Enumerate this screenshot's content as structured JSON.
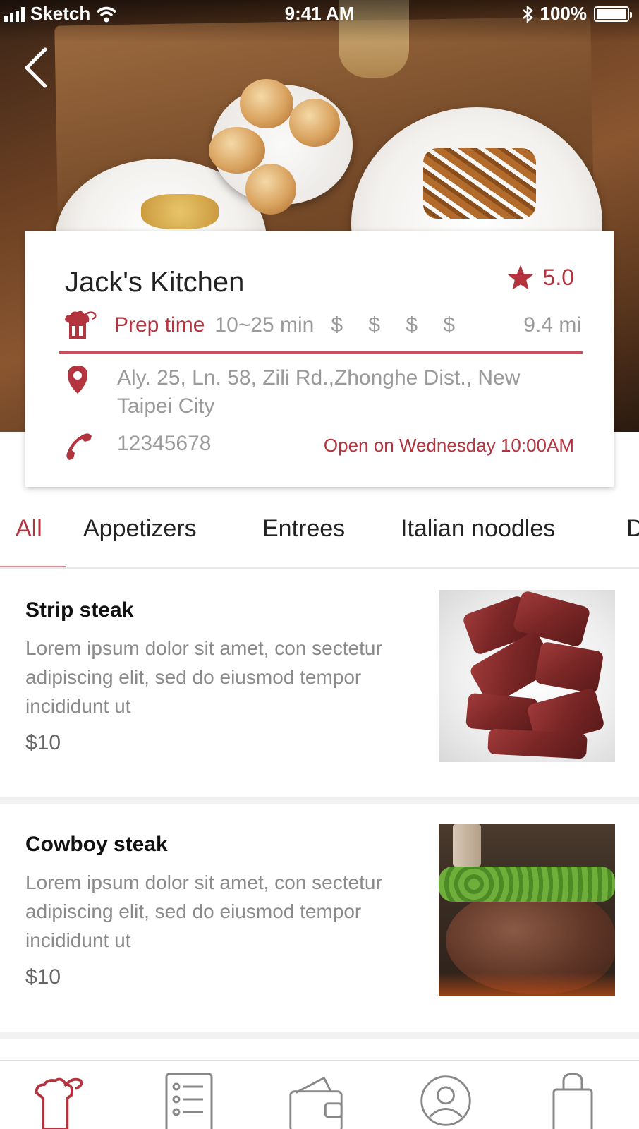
{
  "status_bar": {
    "carrier": "Sketch",
    "time": "9:41 AM",
    "battery": "100%",
    "icons": [
      "signal-icon",
      "wifi-icon",
      "bluetooth-icon",
      "battery-icon"
    ]
  },
  "header": {
    "back_icon": "back-arrow-icon"
  },
  "restaurant": {
    "name": "Jack's Kitchen",
    "rating": "5.0",
    "prep_label": "Prep time",
    "prep_value": "10~25 min",
    "price_level": "$ $ $ $",
    "distance": "9.4 mi",
    "address": "Aly. 25, Ln. 58, Zili Rd.,Zhonghe Dist., New Taipei City",
    "phone": "12345678",
    "hours": "Open on Wednesday 10:00AM"
  },
  "tabs": [
    {
      "label": "All",
      "active": true
    },
    {
      "label": "Appetizers",
      "active": false
    },
    {
      "label": "Entrees",
      "active": false
    },
    {
      "label": "Italian noodles",
      "active": false
    },
    {
      "label": "D",
      "active": false
    }
  ],
  "menu": [
    {
      "title": "Strip steak",
      "description": "Lorem ipsum dolor sit amet, con sectetur adipiscing elit, sed do eiusmod tempor incididunt ut",
      "price": "$10"
    },
    {
      "title": "Cowboy steak",
      "description": "Lorem ipsum dolor sit amet, con sectetur adipiscing elit, sed do eiusmod tempor incididunt ut",
      "price": "$10"
    }
  ],
  "bottom_nav": [
    {
      "icon": "chef-hat-icon",
      "active": true
    },
    {
      "icon": "order-list-icon",
      "active": false
    },
    {
      "icon": "wallet-icon",
      "active": false
    },
    {
      "icon": "profile-icon",
      "active": false
    },
    {
      "icon": "shopping-bag-icon",
      "active": false
    }
  ],
  "colors": {
    "accent": "#b3343f",
    "muted_text": "#9a9a9a",
    "divider": "#c9515b"
  }
}
